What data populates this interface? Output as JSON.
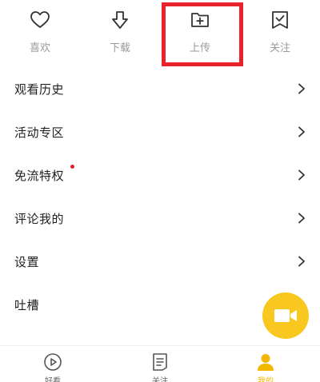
{
  "top_actions": {
    "like_label": "喜欢",
    "download_label": "下载",
    "upload_label": "上传",
    "follow_label": "关注"
  },
  "menu": {
    "items": [
      {
        "label": "观看历史"
      },
      {
        "label": "活动专区"
      },
      {
        "label": "免流特权",
        "has_dot": true
      },
      {
        "label": "评论我的"
      },
      {
        "label": "设置"
      },
      {
        "label": "吐槽"
      }
    ]
  },
  "bottom_nav": {
    "tabs": [
      {
        "label": "好看",
        "icon": "play-circle-icon"
      },
      {
        "label": "关注",
        "icon": "list-doc-icon"
      },
      {
        "label": "我的",
        "icon": "person-icon",
        "active": true
      }
    ]
  },
  "colors": {
    "accent": "#f9c820",
    "highlight": "#e8232c",
    "badge_dot": "#e61e2c",
    "muted_text": "#9a9a9a"
  }
}
